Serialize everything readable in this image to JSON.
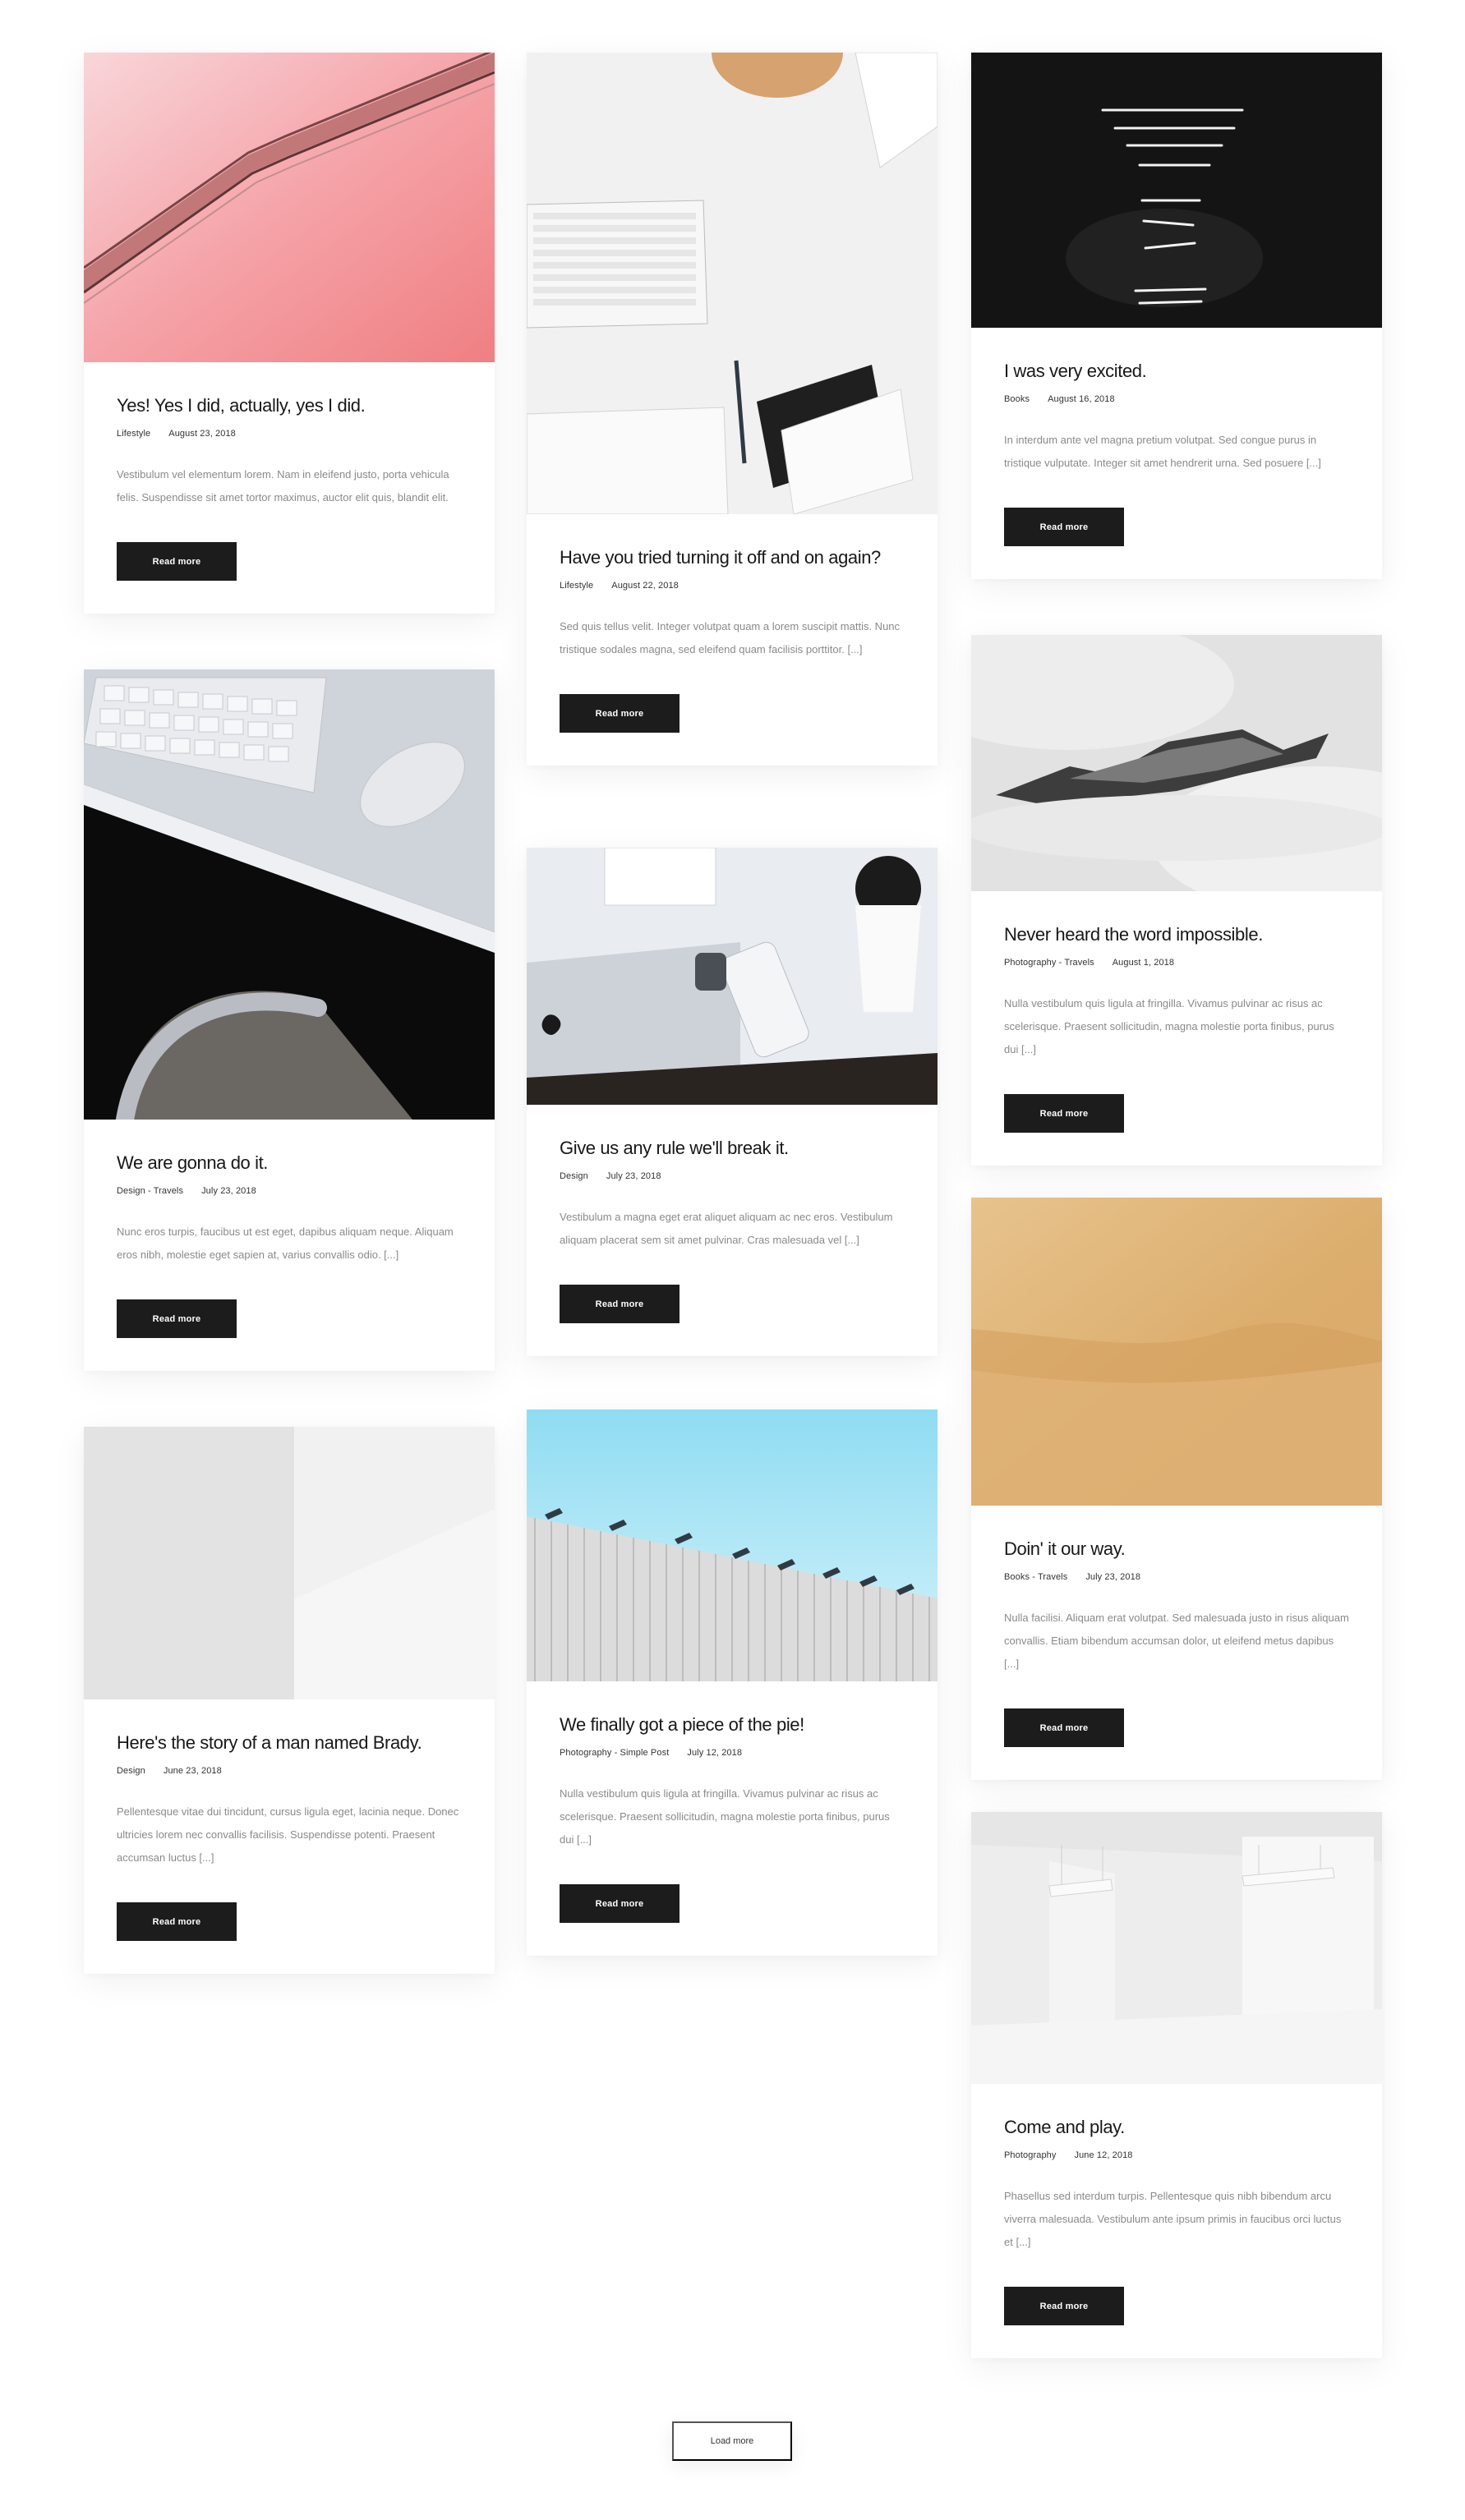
{
  "posts": [
    {
      "title": "Yes! Yes I did, actually, yes I did.",
      "category": "Lifestyle",
      "date": "August 23, 2018",
      "excerpt": "Vestibulum vel elementum lorem. Nam in eleifend justo, porta vehicula felis. Suspendisse sit amet tortor maximus, auctor elit quis, blandit elit.",
      "read_more": "Read more"
    },
    {
      "title": "We are gonna do it.",
      "category": "Design - Travels",
      "date": "July 23, 2018",
      "excerpt": "Nunc eros turpis, faucibus ut est eget, dapibus aliquam neque. Aliquam eros nibh, molestie eget sapien at, varius convallis odio. [...]",
      "read_more": "Read more"
    },
    {
      "title": "Here's the story of a man named Brady.",
      "category": "Design",
      "date": "June 23, 2018",
      "excerpt": "Pellentesque vitae dui tincidunt, cursus ligula eget, lacinia neque. Donec ultricies lorem nec convallis facilisis. Suspendisse potenti. Praesent accumsan luctus [...]",
      "read_more": "Read more"
    },
    {
      "title": "Have you tried turning it off and on again?",
      "category": "Lifestyle",
      "date": "August 22, 2018",
      "excerpt": "Sed quis tellus velit. Integer volutpat quam a lorem suscipit mattis. Nunc tristique sodales magna, sed eleifend quam facilisis porttitor. [...]",
      "read_more": "Read more"
    },
    {
      "title": "Give us any rule we'll break it.",
      "category": "Design",
      "date": "July 23, 2018",
      "excerpt": "Vestibulum a magna eget erat aliquet aliquam ac nec eros. Vestibulum aliquam placerat sem sit amet pulvinar. Cras malesuada vel [...]",
      "read_more": "Read more"
    },
    {
      "title": "We finally got a piece of the pie!",
      "category": "Photography - Simple Post",
      "date": "July 12, 2018",
      "excerpt": "Nulla vestibulum quis ligula at fringilla. Vivamus pulvinar ac risus ac scelerisque. Praesent sollicitudin, magna molestie porta finibus, purus dui [...]",
      "read_more": "Read more"
    },
    {
      "title": "I was very excited.",
      "category": "Books",
      "date": "August 16, 2018",
      "excerpt": "In interdum ante vel magna pretium volutpat. Sed congue purus in tristique vulputate. Integer sit amet hendrerit urna. Sed posuere [...]",
      "read_more": "Read more"
    },
    {
      "title": "Never heard the word impossible.",
      "category": "Photography - Travels",
      "date": "August 1, 2018",
      "excerpt": "Nulla vestibulum quis ligula at fringilla. Vivamus pulvinar ac risus ac scelerisque. Praesent sollicitudin, magna molestie porta finibus, purus dui [...]",
      "read_more": "Read more"
    },
    {
      "title": "Doin' it our way.",
      "category": "Books - Travels",
      "date": "July 23, 2018",
      "excerpt": "Nulla facilisi. Aliquam erat volutpat. Sed malesuada justo in risus aliquam convallis. Etiam bibendum accumsan dolor, ut eleifend metus dapibus [...]",
      "read_more": "Read more"
    },
    {
      "title": "Come and play.",
      "category": "Photography",
      "date": "June 12, 2018",
      "excerpt": "Phasellus sed interdum turpis. Pellentesque quis nibh bibendum arcu viverra malesuada. Vestibulum ante ipsum primis in faucibus orci luctus et [...]",
      "read_more": "Read more"
    }
  ],
  "load_more": "Load more",
  "colors": {
    "button_bg": "#1c1c1c",
    "button_text": "#ffffff",
    "excerpt_text": "#8a8a8a"
  }
}
